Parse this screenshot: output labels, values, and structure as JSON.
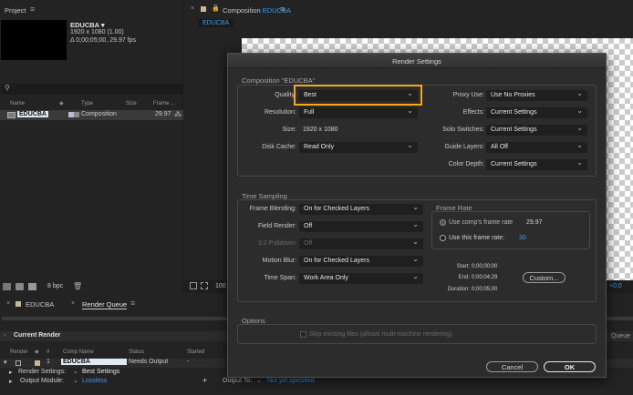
{
  "project_panel": {
    "title": "Project",
    "comp_name": "EDUCBA ▾",
    "comp_res": "1920 x 1080 (1.00)",
    "comp_dur": "Δ 0;00;05;00, 29.97 fps",
    "search_placeholder": "",
    "columns": [
      "Name",
      "Type",
      "Size",
      "Frame ..."
    ],
    "item": {
      "name": "EDUCBA",
      "type": "Composition",
      "fps": "29.97"
    },
    "bpc": "8 bpc"
  },
  "comp_viewer": {
    "tab_prefix": "Composition",
    "tab_name": "EDUCBA",
    "sub_tab": "EDUCBA",
    "zoom": "100",
    "offset": "+0.0"
  },
  "bottom_tabs": {
    "comp": "EDUCBA",
    "render_queue": "Render Queue"
  },
  "render_queue": {
    "current_render": "Current Render",
    "columns": [
      "Render",
      "#",
      "Comp Name",
      "Status",
      "Started"
    ],
    "row": {
      "num": "1",
      "comp": "EDUCBA",
      "status": "Needs Output",
      "started": "-"
    },
    "render_settings_label": "Render Settings:",
    "render_settings_value": "Best Settings",
    "output_module_label": "Output Module:",
    "output_module_value": "Lossless",
    "output_to_label": "Output To:",
    "output_to_value": "Not yet specified",
    "right_label": "Queue"
  },
  "dialog": {
    "title": "Render Settings",
    "comp_label": "Composition \"EDUCBA\"",
    "quality_label": "Quality:",
    "quality_value": "Best",
    "resolution_label": "Resolution:",
    "resolution_value": "Full",
    "size_label": "Size:",
    "size_value": "1920 x 1080",
    "disk_cache_label": "Disk Cache:",
    "disk_cache_value": "Read Only",
    "proxy_use_label": "Proxy Use:",
    "proxy_use_value": "Use No Proxies",
    "effects_label": "Effects:",
    "effects_value": "Current Settings",
    "solo_label": "Solo Switches:",
    "solo_value": "Current Settings",
    "guide_label": "Guide Layers:",
    "guide_value": "All Off",
    "color_depth_label": "Color Depth:",
    "color_depth_value": "Current Settings",
    "time_sampling_title": "Time Sampling",
    "frame_blending_label": "Frame Blending:",
    "frame_blending_value": "On for Checked Layers",
    "field_render_label": "Field Render:",
    "field_render_value": "Off",
    "pulldown_label": "3:2 Pulldown:",
    "pulldown_value": "Off",
    "motion_blur_label": "Motion Blur:",
    "motion_blur_value": "On for Checked Layers",
    "time_span_label": "Time Span:",
    "time_span_value": "Work Area Only",
    "frame_rate_title": "Frame Rate",
    "use_comp_rate": "Use comp's frame rate",
    "comp_rate_value": "29.97",
    "use_this_rate": "Use this frame rate:",
    "this_rate_value": "30",
    "start_label": "Start:",
    "start_value": "0;00;00;00",
    "end_label": "End:",
    "end_value": "0;00;04;29",
    "duration_label": "Duration:",
    "duration_value": "0;00;05;00",
    "custom_button": "Custom...",
    "options_title": "Options",
    "skip_existing": "Skip existing files (allows multi-machine rendering)",
    "cancel_button": "Cancel",
    "ok_button": "OK"
  },
  "colors": {
    "accent": "#2d8ceb",
    "highlight": "#f5a623",
    "dialog_bg": "#2c2c2c"
  }
}
